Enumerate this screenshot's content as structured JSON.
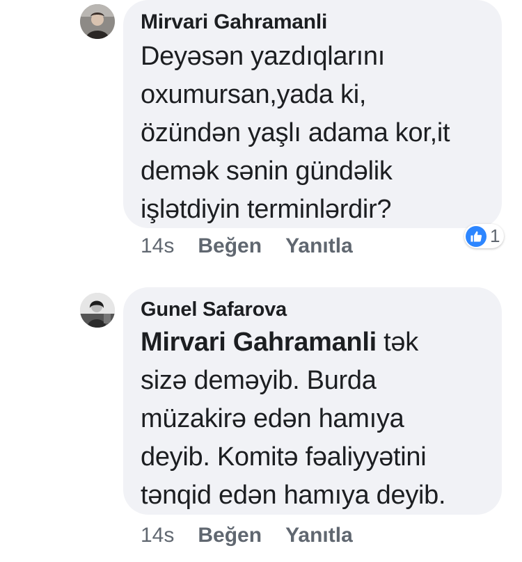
{
  "comments": [
    {
      "author": "Mirvari Gahramanli",
      "text_lines": [
        "Deyəsən yazdıqlarını",
        "oxumursan,yada ki,",
        "özündən yaşlı adama kor,it",
        "demək sənin gündəlik",
        "işlətdiyin terminlərdir?"
      ],
      "time": "14s",
      "like_label": "Beğen",
      "reply_label": "Yanıtla",
      "reaction_count": "1",
      "reaction_icon": "like-icon",
      "reaction_color": "#2d86ff"
    },
    {
      "author": "Gunel Safarova",
      "mention": "Mirvari Gahramanli",
      "first_line_rest": " tək",
      "text_lines": [
        "sizə deməyib. Burda",
        "müzakirə edən hamıya",
        "deyib. Komitə fəaliyyətini",
        "tənqid edən hamıya deyib."
      ],
      "time": "14s",
      "like_label": "Beğen",
      "reply_label": "Yanıtla"
    }
  ],
  "colors": {
    "bubble_bg": "#f1f2f6",
    "meta_text": "#606770",
    "body_text": "#1c1e21"
  }
}
